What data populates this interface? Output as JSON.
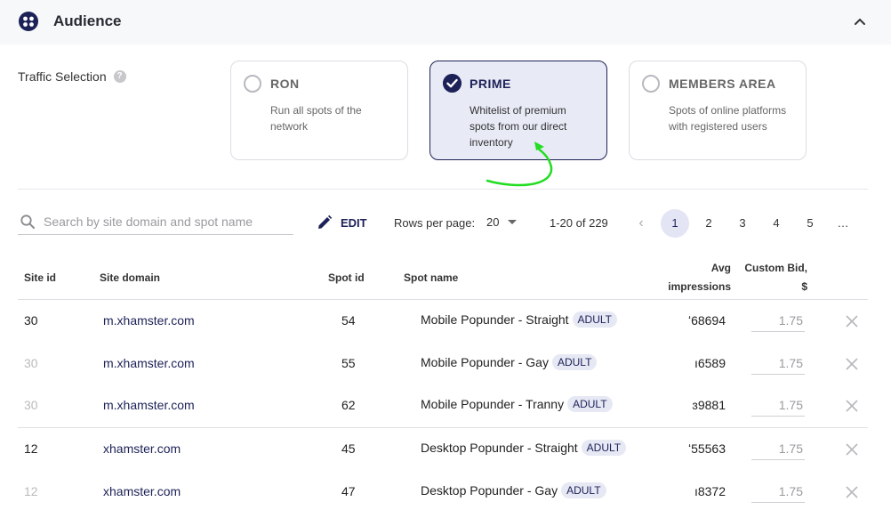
{
  "header": {
    "title": "Audience"
  },
  "traffic": {
    "label": "Traffic Selection",
    "help": "?",
    "options": [
      {
        "title": "RON",
        "desc": "Run all spots of the network",
        "selected": false
      },
      {
        "title": "PRIME",
        "desc": "Whitelist of premium spots from our direct inventory",
        "selected": true
      },
      {
        "title": "MEMBERS AREA",
        "desc": "Spots of online platforms with registered users",
        "selected": false
      }
    ]
  },
  "toolbar": {
    "search_placeholder": "Search by site domain and spot name",
    "edit_label": "EDIT",
    "rows_per_page_label": "Rows per page:",
    "rows_per_page_value": "20",
    "range": "1-20 of 229",
    "pages": [
      "1",
      "2",
      "3",
      "4",
      "5",
      "…"
    ],
    "prev": "‹"
  },
  "table": {
    "columns": {
      "site_id": "Site id",
      "site_domain": "Site domain",
      "spot_id": "Spot id",
      "spot_name": "Spot name",
      "avg_impr_1": "Avg",
      "avg_impr_2": "impressions",
      "bid_1": "Custom Bid,",
      "bid_2": "$"
    },
    "rows": [
      {
        "site_id": "30",
        "domain": "m.xhamster.com",
        "spot_id": "54",
        "spot_name": "Mobile Popunder - Straight",
        "badge": "ADULT",
        "impressions": "ʻ68694",
        "bid": "1.75",
        "dim": false
      },
      {
        "site_id": "30",
        "domain": "m.xhamster.com",
        "spot_id": "55",
        "spot_name": "Mobile Popunder - Gay",
        "badge": "ADULT",
        "impressions": "ı6589",
        "bid": "1.75",
        "dim": true
      },
      {
        "site_id": "30",
        "domain": "m.xhamster.com",
        "spot_id": "62",
        "spot_name": "Mobile Popunder - Tranny",
        "badge": "ADULT",
        "impressions": "ɜ9881",
        "bid": "1.75",
        "dim": true
      },
      {
        "site_id": "12",
        "domain": "xhamster.com",
        "spot_id": "45",
        "spot_name": "Desktop Popunder - Straight",
        "badge": "ADULT",
        "impressions": "ʻ55563",
        "bid": "1.75",
        "dim": false
      },
      {
        "site_id": "12",
        "domain": "xhamster.com",
        "spot_id": "47",
        "spot_name": "Desktop Popunder - Gay",
        "badge": "ADULT",
        "impressions": "ı8372",
        "bid": "1.75",
        "dim": true
      }
    ]
  }
}
